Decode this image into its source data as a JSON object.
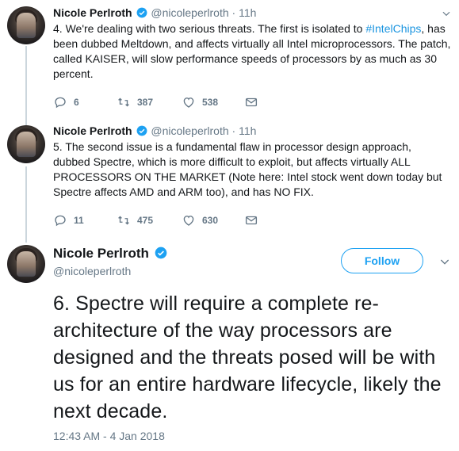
{
  "colors": {
    "accent": "#1da1f2",
    "muted": "#657786",
    "text": "#14171a",
    "line": "#ccd6dd"
  },
  "tweets": [
    {
      "name": "Nicole Perlroth",
      "handle": "@nicoleperlroth",
      "sep": "·",
      "time": "11h",
      "text_before": "4. We're dealing with two serious threats. The first is isolated to ",
      "hashtag": "#IntelChips",
      "text_after": ", has been dubbed Meltdown, and affects virtually all Intel microprocessors. The patch, called KAISER, will slow performance speeds of processors by as much as 30 percent.",
      "replies": "6",
      "retweets": "387",
      "likes": "538"
    },
    {
      "name": "Nicole Perlroth",
      "handle": "@nicoleperlroth",
      "sep": "·",
      "time": "11h",
      "text": "5. The second issue is a fundamental flaw in processor design approach, dubbed Spectre, which is more difficult to exploit, but affects virtually ALL PROCESSORS ON THE MARKET (Note here: Intel stock went down today but Spectre affects AMD and ARM too), and has NO FIX.",
      "replies": "11",
      "retweets": "475",
      "likes": "630"
    }
  ],
  "main_tweet": {
    "name": "Nicole Perlroth",
    "handle": "@nicoleperlroth",
    "follow_label": "Follow",
    "text": "6. Spectre will require a complete re-architecture of the way processors are designed and the threats posed will be with us for an entire hardware lifecycle, likely the next decade.",
    "timestamp": "12:43 AM - 4 Jan 2018"
  },
  "icons": {
    "reply": "reply-icon",
    "retweet": "retweet-icon",
    "like": "heart-icon",
    "dm": "envelope-icon",
    "verified": "verified-badge-icon",
    "caret": "chevron-down-icon"
  }
}
